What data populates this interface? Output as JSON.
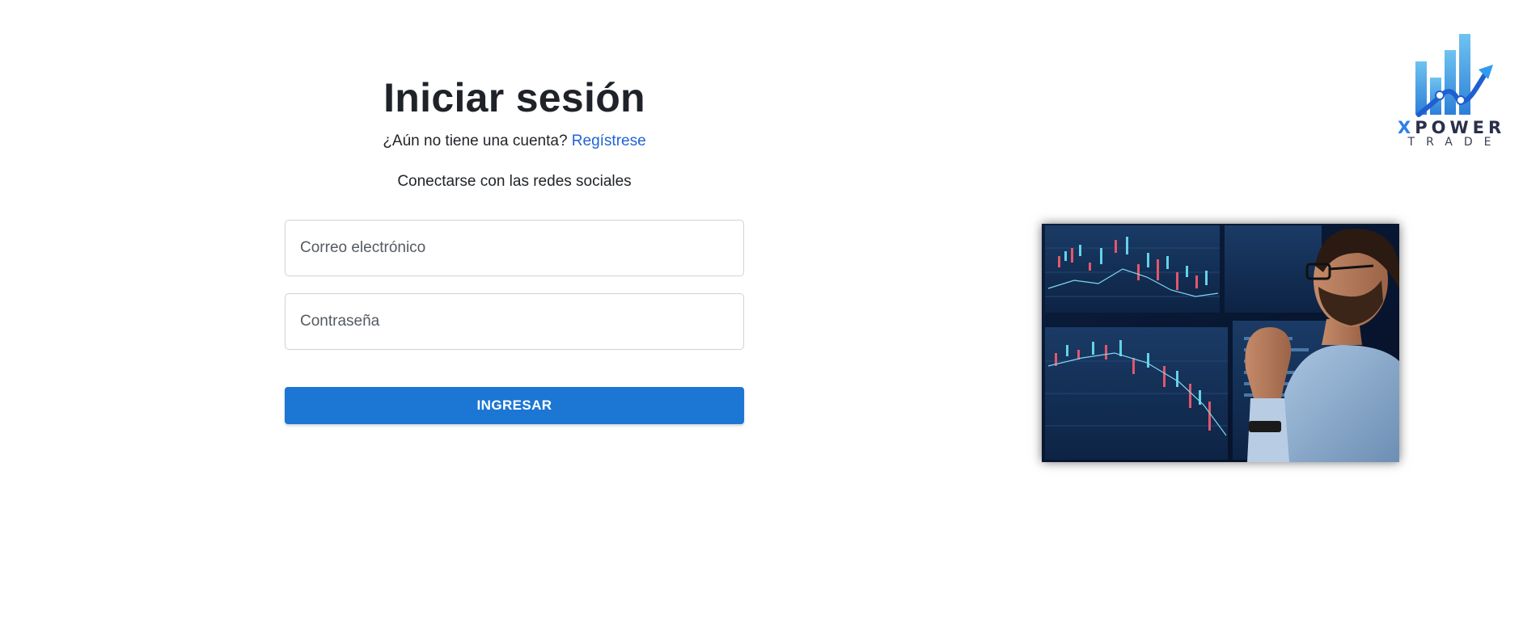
{
  "login": {
    "title": "Iniciar sesión",
    "signup_prompt": "¿Aún no tiene una cuenta?",
    "signup_link": "Regístrese",
    "social_text": "Conectarse con las redes sociales",
    "email_placeholder": "Correo electrónico",
    "password_placeholder": "Contraseña",
    "submit_label": "INGRESAR"
  },
  "logo": {
    "brand_first": "X",
    "brand_rest": "POWER",
    "brand_sub": "TRADE"
  },
  "image": {
    "icon": "trader-watching-charts-photo"
  },
  "colors": {
    "primary_button": "#1b76d4",
    "link": "#1f63d6",
    "logo_blue": "#2f7ee8"
  }
}
